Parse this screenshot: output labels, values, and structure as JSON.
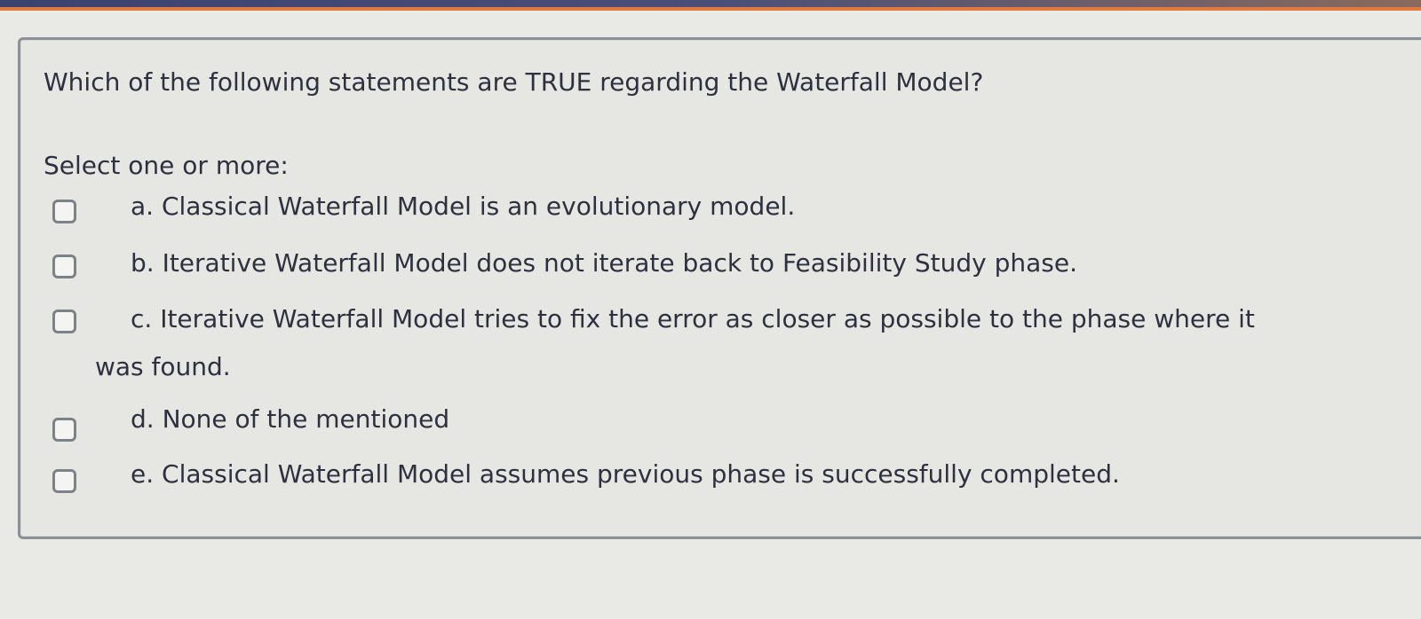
{
  "question": {
    "text": "Which of the following statements are TRUE regarding the Waterfall Model?",
    "prompt": "Select one or more:"
  },
  "options": [
    {
      "label": "a. Classical Waterfall Model is an evolutionary model.",
      "checked": false
    },
    {
      "label": "b. Iterative Waterfall Model does not iterate back to Feasibility Study phase.",
      "checked": false
    },
    {
      "label": "c. Iterative Waterfall Model tries to fix the error as closer as possible to the phase where it was found.",
      "checked": false
    },
    {
      "label": "d. None of the mentioned",
      "checked": false
    },
    {
      "label": "e. Classical Waterfall Model assumes previous phase is successfully completed.",
      "checked": false
    }
  ]
}
